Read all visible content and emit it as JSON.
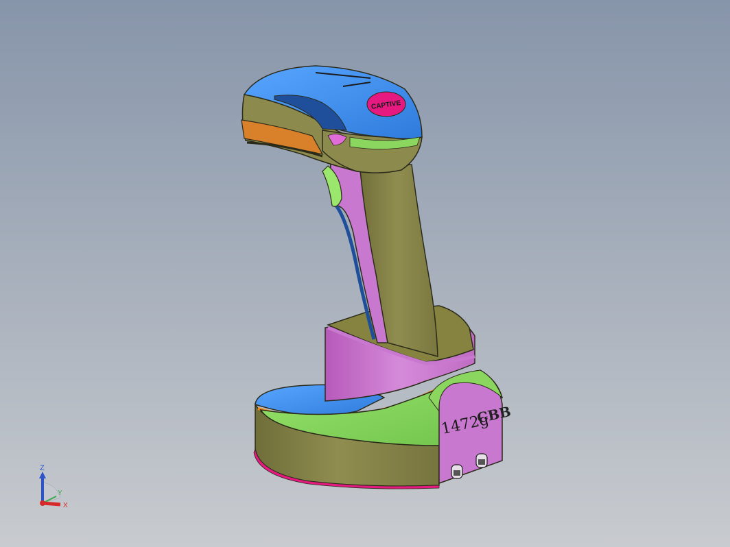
{
  "viewport": {
    "background_top": "#8795aa",
    "background_bottom": "#c8cbcf"
  },
  "model": {
    "logo_text": "CAPTIVE",
    "base_engraving": {
      "weight": "1472g",
      "brand": "CBB"
    },
    "face_colors": {
      "blue": "#3f8fe8",
      "navy": "#1f4f9a",
      "olive": "#8c8a4c",
      "olive_dark": "#6f6e3a",
      "magenta": "#c978cf",
      "pink": "#e5197f",
      "green": "#8ad65f",
      "orange": "#d8802a",
      "light_orange": "#f2a24a",
      "slate": "#5b6d7f"
    }
  },
  "triad": {
    "z_label": "Z",
    "y_label": "Y",
    "x_label": "X",
    "z_color": "#2d53c9",
    "y_color": "#38a84a",
    "x_color": "#d62a2a"
  }
}
